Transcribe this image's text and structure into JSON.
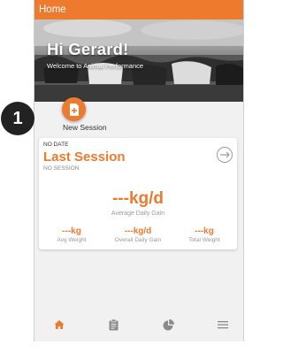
{
  "appbar": {
    "title": "Home"
  },
  "hero": {
    "greeting": "Hi Gerard!",
    "subtitle": "Welcome to Animal Performance"
  },
  "new_session": {
    "label": "New Session",
    "icon": "add-document-icon"
  },
  "step_badge": {
    "number": "1"
  },
  "last_session": {
    "date": "NO DATE",
    "title": "Last Session",
    "session": "NO SESSION",
    "adg_value": "---kg/d",
    "adg_label": "Average Daily Gain",
    "stats": [
      {
        "value": "---kg",
        "label": "Avg Weight"
      },
      {
        "value": "---kg/d",
        "label": "Overall Daily Gain"
      },
      {
        "value": "---kg",
        "label": "Total Weight"
      }
    ]
  },
  "tabs": [
    {
      "icon": "home-icon",
      "active": true
    },
    {
      "icon": "clipboard-icon",
      "active": false
    },
    {
      "icon": "pie-chart-icon",
      "active": false
    },
    {
      "icon": "menu-icon",
      "active": false
    }
  ],
  "colors": {
    "accent": "#ee7a2e",
    "inactive_icon": "#8a8a8a"
  }
}
